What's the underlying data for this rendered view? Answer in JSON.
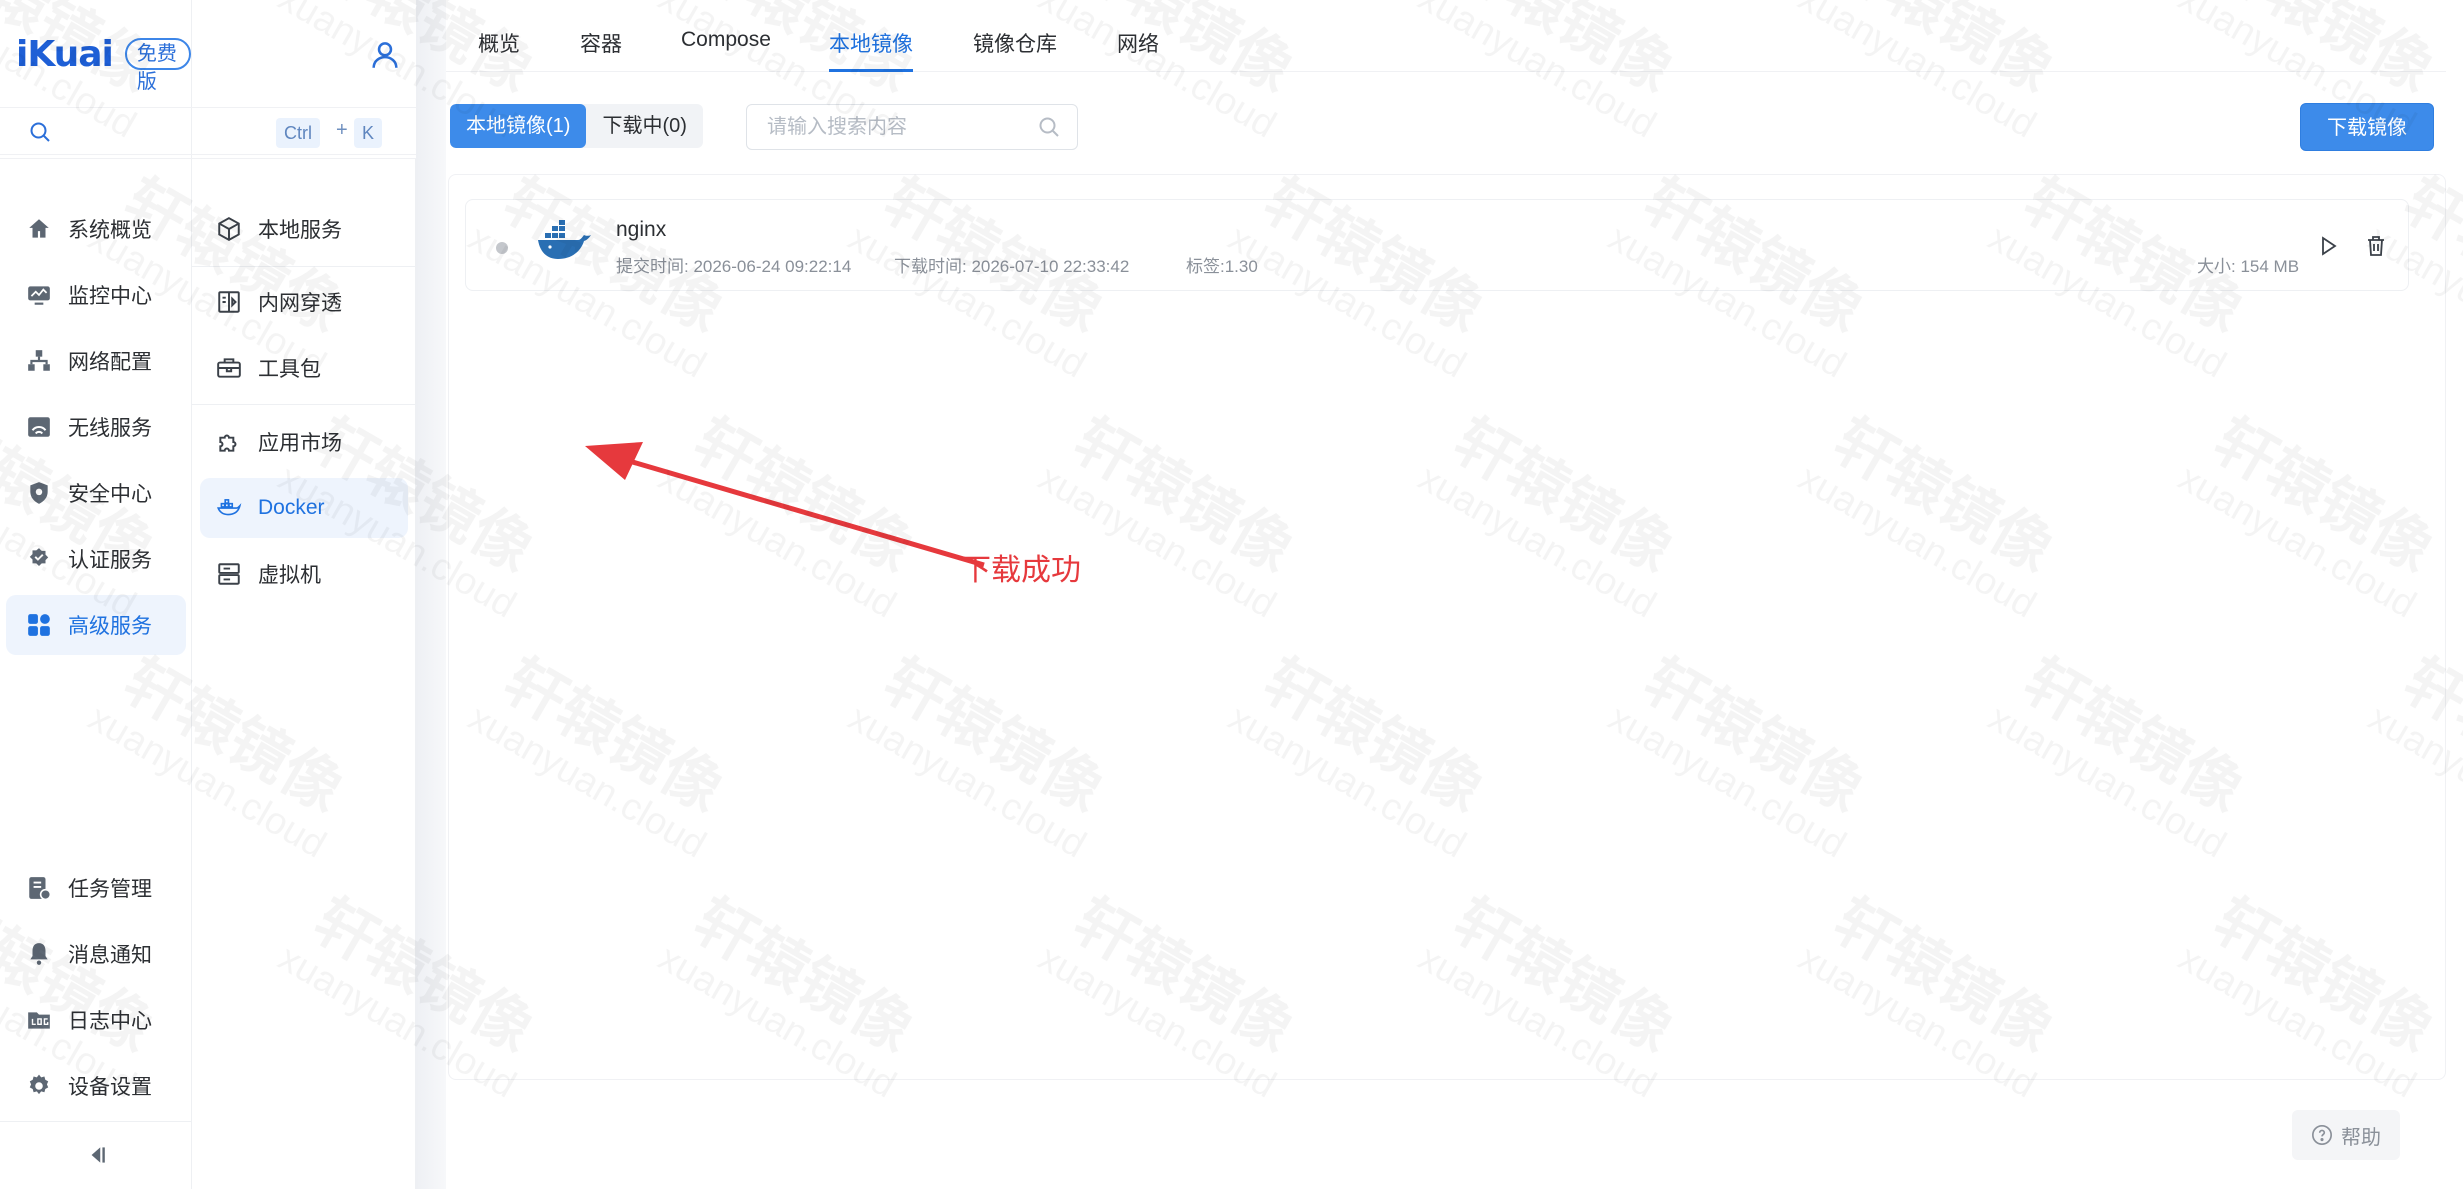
{
  "brand": {
    "name": "iKuai",
    "edition": "免费版"
  },
  "search": {
    "kbd_ctrl": "Ctrl",
    "kbd_plus": "+",
    "kbd_k": "K"
  },
  "nav": {
    "items": [
      {
        "label": "系统概览",
        "icon": "home-icon"
      },
      {
        "label": "监控中心",
        "icon": "monitor-icon"
      },
      {
        "label": "网络配置",
        "icon": "network-icon"
      },
      {
        "label": "无线服务",
        "icon": "wireless-icon"
      },
      {
        "label": "安全中心",
        "icon": "shield-icon"
      },
      {
        "label": "认证服务",
        "icon": "badge-check-icon"
      },
      {
        "label": "高级服务",
        "icon": "grid-icon"
      }
    ],
    "bottom": [
      {
        "label": "任务管理",
        "icon": "task-icon"
      },
      {
        "label": "消息通知",
        "icon": "bell-icon"
      },
      {
        "label": "日志中心",
        "icon": "log-icon"
      },
      {
        "label": "设备设置",
        "icon": "gear-icon"
      }
    ]
  },
  "subnav": {
    "items": [
      {
        "label": "本地服务"
      },
      {
        "label": "内网穿透"
      },
      {
        "label": "工具包"
      },
      {
        "label": "应用市场"
      },
      {
        "label": "Docker"
      },
      {
        "label": "虚拟机"
      }
    ]
  },
  "tabs": [
    "概览",
    "容器",
    "Compose",
    "本地镜像",
    "镜像仓库",
    "网络"
  ],
  "toolbar": {
    "seg_local": "本地镜像(1)",
    "seg_downloading": "下载中(0)",
    "search_placeholder": "请输入搜索内容",
    "download_button": "下载镜像"
  },
  "images": [
    {
      "name": "nginx",
      "submitted": "提交时间: 2026-06-24 09:22:14",
      "downloaded": "下载时间: 2026-07-10 22:33:42",
      "tag": "标签:1.30",
      "size": "大小: 154 MB"
    }
  ],
  "annotation": {
    "text": "下载成功",
    "color": "#e6393d"
  },
  "help": {
    "label": "帮助"
  },
  "watermark": {
    "main": "轩辕镜像",
    "sub": "xuanyuan.cloud"
  },
  "colors": {
    "accent": "#1f72e0",
    "primary": "#3d8bea"
  }
}
